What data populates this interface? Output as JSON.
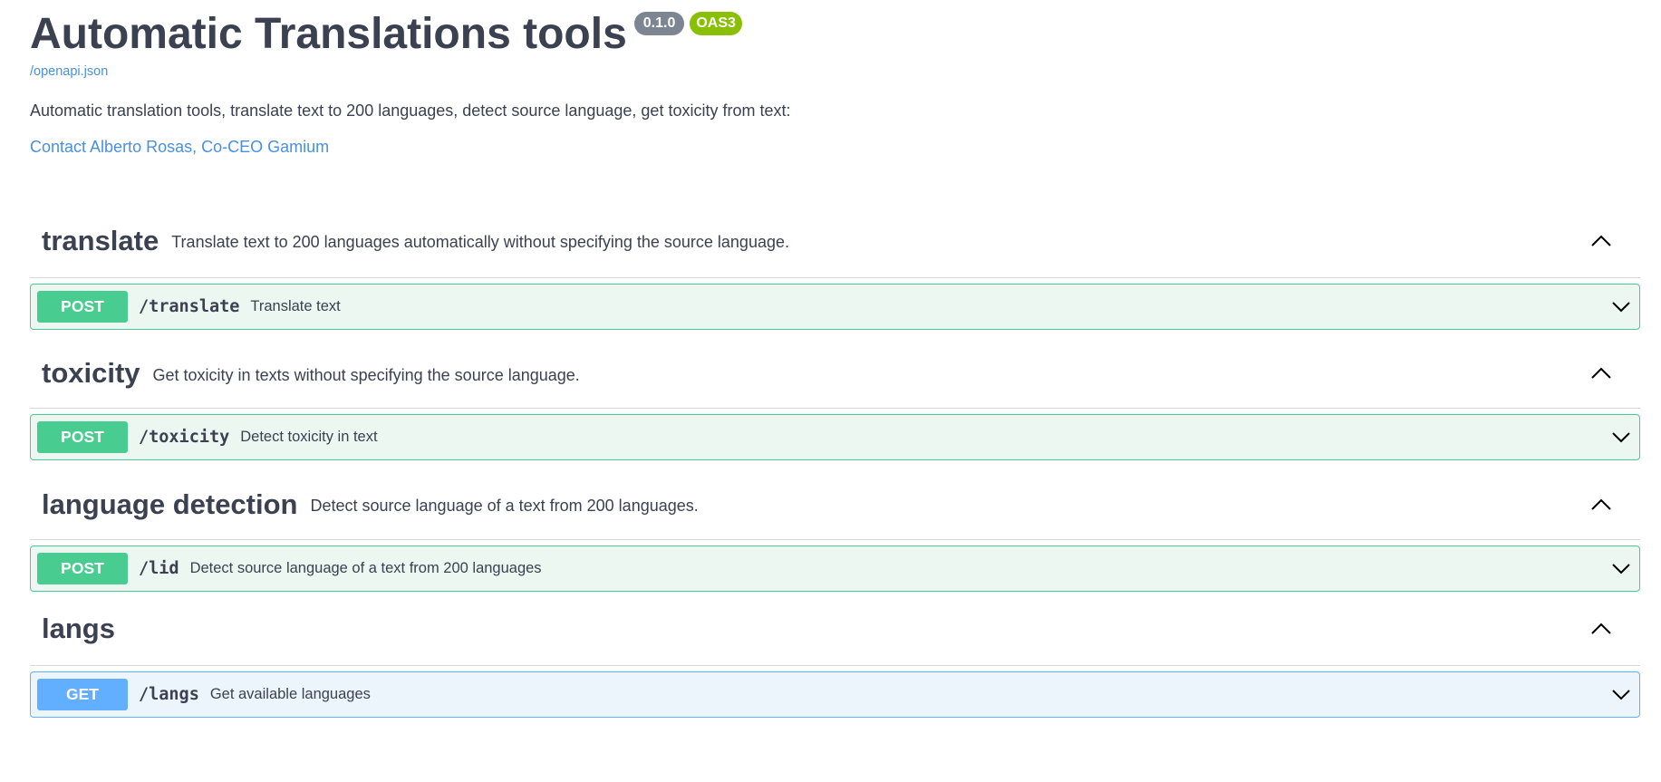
{
  "info": {
    "title": "Automatic Translations tools",
    "version": "0.1.0",
    "oas_badge": "OAS3",
    "spec_link": "/openapi.json",
    "description": "Automatic translation tools, translate text to 200 languages, detect source language, get toxicity from text:",
    "contact": "Contact Alberto Rosas, Co-CEO Gamium"
  },
  "colors": {
    "post": "#49cc90",
    "get": "#61affe",
    "link": "#4990e2",
    "text": "#3b4151"
  },
  "tags": [
    {
      "name": "translate",
      "description": "Translate text to 200 languages automatically without specifying the source language.",
      "operation": {
        "method": "POST",
        "path": "/translate",
        "summary": "Translate text"
      }
    },
    {
      "name": "toxicity",
      "description": "Get toxicity in texts without specifying the source language.",
      "operation": {
        "method": "POST",
        "path": "/toxicity",
        "summary": "Detect toxicity in text"
      }
    },
    {
      "name": "language detection",
      "description": "Detect source language of a text from 200 languages.",
      "operation": {
        "method": "POST",
        "path": "/lid",
        "summary": "Detect source language of a text from 200 languages"
      }
    },
    {
      "name": "langs",
      "description": "",
      "operation": {
        "method": "GET",
        "path": "/langs",
        "summary": "Get available languages"
      }
    }
  ]
}
